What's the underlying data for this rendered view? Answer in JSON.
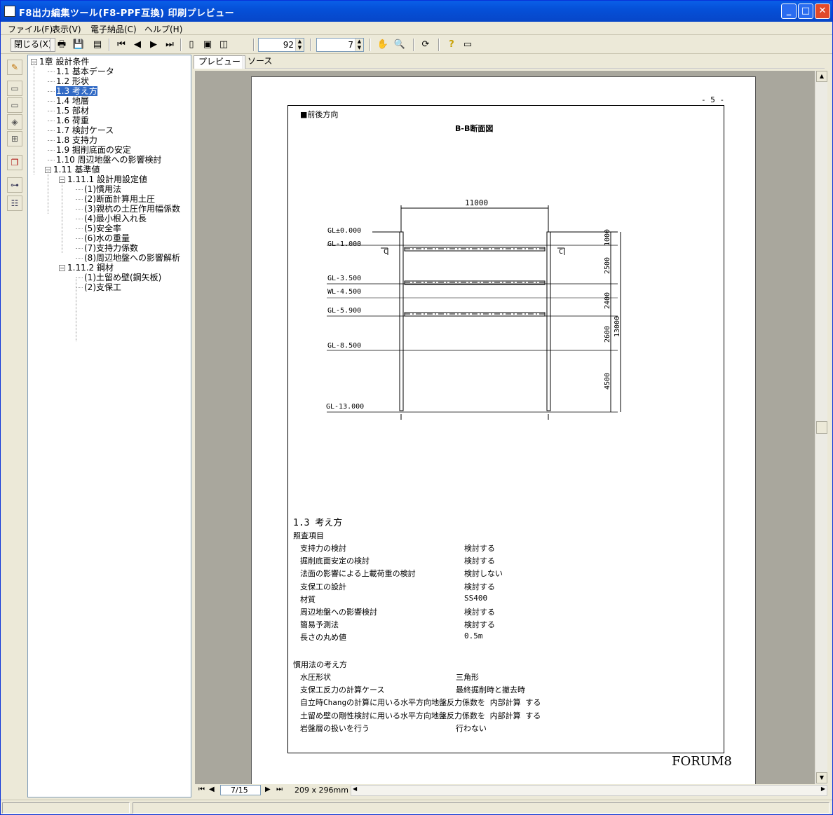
{
  "window": {
    "title": "F8出力編集ツール(F8-PPF互換) 印刷プレビュー"
  },
  "menu": [
    "ファイル(F)",
    "表示(V)",
    "電子納品(C)",
    "ヘルプ(H)"
  ],
  "toolbar": {
    "close_label": "閉じる(X)",
    "zoom_value": "92",
    "page_value": "7"
  },
  "tabs": [
    "プレビュー",
    "ソース"
  ],
  "tree": {
    "items": [
      {
        "label": "1章 設計条件",
        "level": 0
      },
      {
        "label": "1.1 基本データ",
        "level": 1
      },
      {
        "label": "1.2 形状",
        "level": 1
      },
      {
        "label": "1.3 考え方",
        "level": 1,
        "selected": true
      },
      {
        "label": "1.4 地層",
        "level": 1
      },
      {
        "label": "1.5 部材",
        "level": 1
      },
      {
        "label": "1.6 荷重",
        "level": 1
      },
      {
        "label": "1.7 検討ケース",
        "level": 1
      },
      {
        "label": "1.8 支持力",
        "level": 1
      },
      {
        "label": "1.9 掘削底面の安定",
        "level": 1
      },
      {
        "label": "1.10 周辺地盤への影響検討",
        "level": 1
      },
      {
        "label": "1.11 基準値",
        "level": 1
      },
      {
        "label": "1.11.1 設計用設定値",
        "level": 2
      },
      {
        "label": "(1)慣用法",
        "level": 3
      },
      {
        "label": "(2)断面計算用土圧",
        "level": 3
      },
      {
        "label": "(3)親杭の土圧作用幅係数",
        "level": 3
      },
      {
        "label": "(4)最小根入れ長",
        "level": 3
      },
      {
        "label": "(5)安全率",
        "level": 3
      },
      {
        "label": "(6)水の重量",
        "level": 3
      },
      {
        "label": "(7)支持力係数",
        "level": 3
      },
      {
        "label": "(8)周辺地盤への影響解析",
        "level": 3
      },
      {
        "label": "1.11.2 鋼材",
        "level": 2
      },
      {
        "label": "(1)土留め壁(鋼矢板)",
        "level": 3
      },
      {
        "label": "(2)支保工",
        "level": 3
      }
    ]
  },
  "page": {
    "page_number": "- 5 -",
    "section_header": "■前後方向",
    "diagram_title": "B-B断面図",
    "dimension_top": "11000",
    "gl_labels": [
      "GL±0.000",
      "GL-1.000",
      "GL-3.500",
      "WL-4.500",
      "GL-5.900",
      "GL-8.500",
      "GL-13.000"
    ],
    "dim_right": [
      "1000",
      "2500",
      "2400",
      "2600",
      "4500"
    ],
    "dim_total": "13000",
    "c_label": "C",
    "heading": "1.3 考え方",
    "subhead1": "照査項目",
    "rows1": [
      {
        "k": "支持力の検討",
        "v": "検討する"
      },
      {
        "k": "掘削底面安定の検討",
        "v": "検討する"
      },
      {
        "k": "法面の影響による上載荷重の検討",
        "v": "検討しない"
      },
      {
        "k": "支保工の設計",
        "v": "検討する"
      },
      {
        "k": "材質",
        "v": "SS400"
      },
      {
        "k": "周辺地盤への影響検討",
        "v": "検討する"
      },
      {
        "k": "簡易予測法",
        "v": "検討する"
      },
      {
        "k": "長さの丸め値",
        "v": "0.5m"
      }
    ],
    "subhead2": "慣用法の考え方",
    "rows2": [
      {
        "k": "水圧形状",
        "v": "三角形"
      },
      {
        "k": "支保工反力の計算ケース",
        "v": "最終掘削時と撤去時"
      },
      {
        "k": "自立時Changの計算に用いる水平方向地盤反力係数を 内部計算 する",
        "v": ""
      },
      {
        "k": "土留め壁の剛性検討に用いる水平方向地盤反力係数を 内部計算 する",
        "v": ""
      },
      {
        "k": "岩盤層の扱いを行う",
        "v": "行わない"
      }
    ],
    "footer_logo": "FORUM8"
  },
  "navbar": {
    "page_indicator": "7/15",
    "paper_size": "209 x 296mm"
  }
}
